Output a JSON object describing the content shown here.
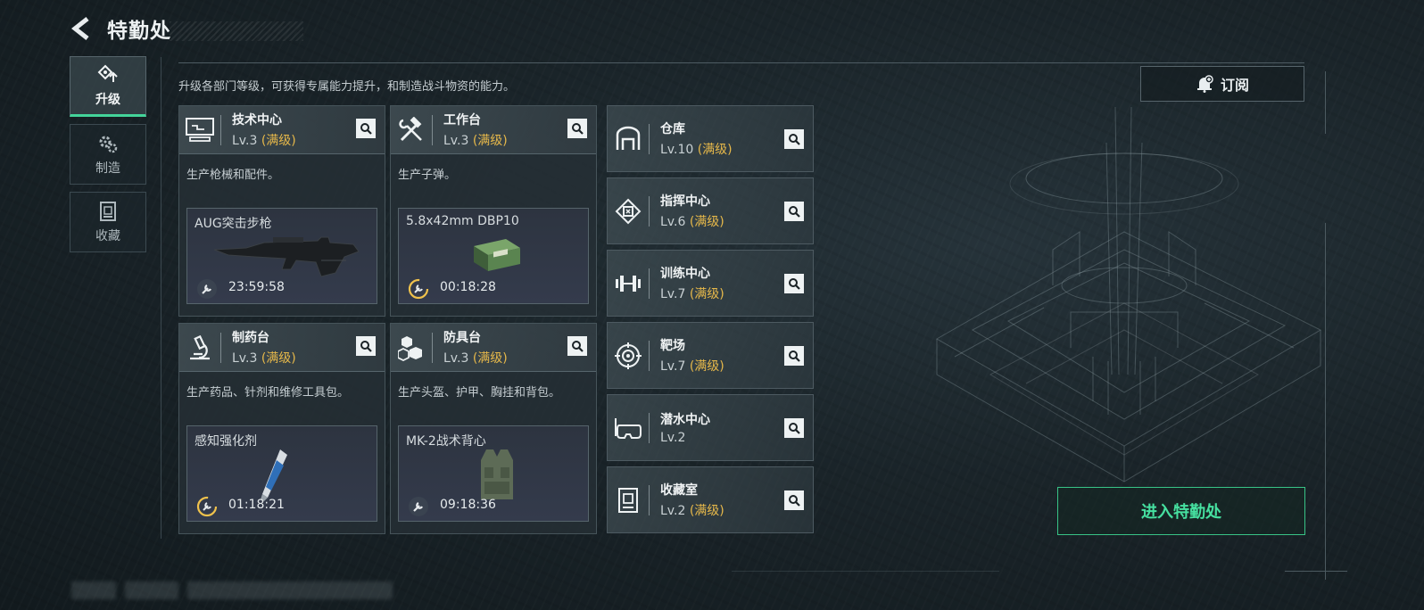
{
  "header": {
    "title": "特勤处"
  },
  "nav": [
    {
      "label": "升级",
      "icon": "upgrade-icon",
      "active": true
    },
    {
      "label": "制造",
      "icon": "gears-icon",
      "active": false
    },
    {
      "label": "收藏",
      "icon": "collection-icon",
      "active": false
    }
  ],
  "description": "升级各部门等级，可获得专属能力提升，和制造战斗物资的能力。",
  "subscribe": {
    "label": "订阅"
  },
  "maxed_label": "(满级)",
  "production_cards": [
    {
      "name": "技术中心",
      "level": "Lv.3",
      "maxed": true,
      "desc": "生产枪械和配件。",
      "product": "AUG突击步枪",
      "time": "23:59:58"
    },
    {
      "name": "工作台",
      "level": "Lv.3",
      "maxed": true,
      "desc": "生产子弹。",
      "product": "5.8x42mm DBP10",
      "time": "00:18:28"
    },
    {
      "name": "制药台",
      "level": "Lv.3",
      "maxed": true,
      "desc": "生产药品、针剂和维修工具包。",
      "product": "感知强化剂",
      "time": "01:18:21"
    },
    {
      "name": "防具台",
      "level": "Lv.3",
      "maxed": true,
      "desc": "生产头盔、护甲、胸挂和背包。",
      "product": "MK-2战术背心",
      "time": "09:18:36"
    }
  ],
  "facilities": [
    {
      "name": "仓库",
      "level": "Lv.10",
      "maxed": true
    },
    {
      "name": "指挥中心",
      "level": "Lv.6",
      "maxed": true
    },
    {
      "name": "训练中心",
      "level": "Lv.7",
      "maxed": true
    },
    {
      "name": "靶场",
      "level": "Lv.7",
      "maxed": true
    },
    {
      "name": "潜水中心",
      "level": "Lv.2",
      "maxed": false
    },
    {
      "name": "收藏室",
      "level": "Lv.2",
      "maxed": true
    }
  ],
  "enter_button": {
    "label": "进入特勤处"
  },
  "colors": {
    "accent_green": "#46e0a0",
    "maxed_gold": "#e6b84a"
  }
}
